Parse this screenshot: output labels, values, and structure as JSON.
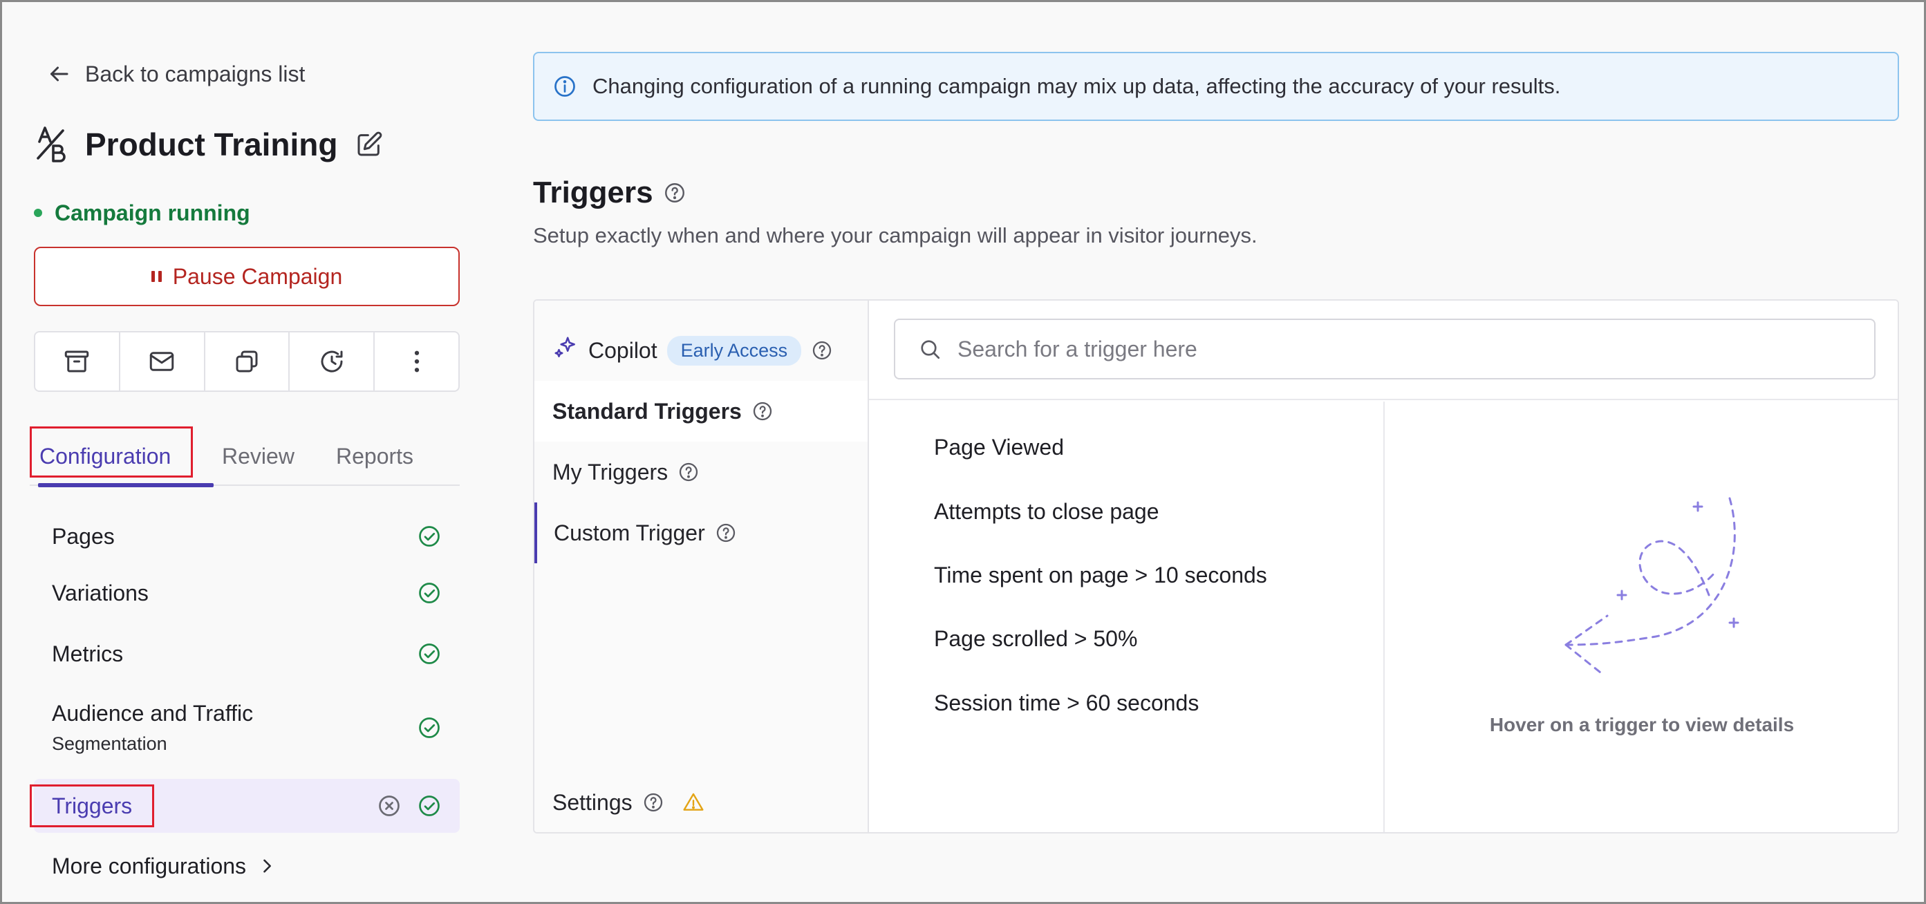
{
  "sidebar": {
    "back_label": "Back to campaigns list",
    "campaign_title": "Product Training",
    "status_label": "Campaign running",
    "pause_label": "Pause Campaign",
    "tabs": [
      {
        "label": "Configuration"
      },
      {
        "label": "Review"
      },
      {
        "label": "Reports"
      }
    ],
    "nav": [
      {
        "label": "Pages"
      },
      {
        "label": "Variations"
      },
      {
        "label": "Metrics"
      },
      {
        "label": "Audience and Traffic",
        "sublabel": "Segmentation"
      },
      {
        "label": "Triggers"
      }
    ],
    "more_label": "More configurations"
  },
  "banner": {
    "text": "Changing configuration of a running campaign may mix up data, affecting the accuracy of your results."
  },
  "section": {
    "title": "Triggers",
    "description": "Setup exactly when and where your campaign will appear in visitor journeys."
  },
  "panel": {
    "copilot_label": "Copilot",
    "copilot_badge": "Early Access",
    "categories": [
      {
        "label": "Standard Triggers"
      },
      {
        "label": "My Triggers"
      },
      {
        "label": "Custom Trigger"
      }
    ],
    "settings_label": "Settings",
    "search_placeholder": "Search for a trigger here",
    "triggers": [
      "Page Viewed",
      "Attempts to close page",
      "Time spent on page > 10 seconds",
      "Page scrolled > 50%",
      "Session time > 60 seconds"
    ],
    "details_hint": "Hover on a trigger to view details"
  },
  "colors": {
    "accent": "#4a3cb0",
    "success": "#157a3d",
    "danger": "#b42520",
    "info_border": "#8cc3ee",
    "highlight": "#e01e2e",
    "warning": "#e3a416"
  }
}
